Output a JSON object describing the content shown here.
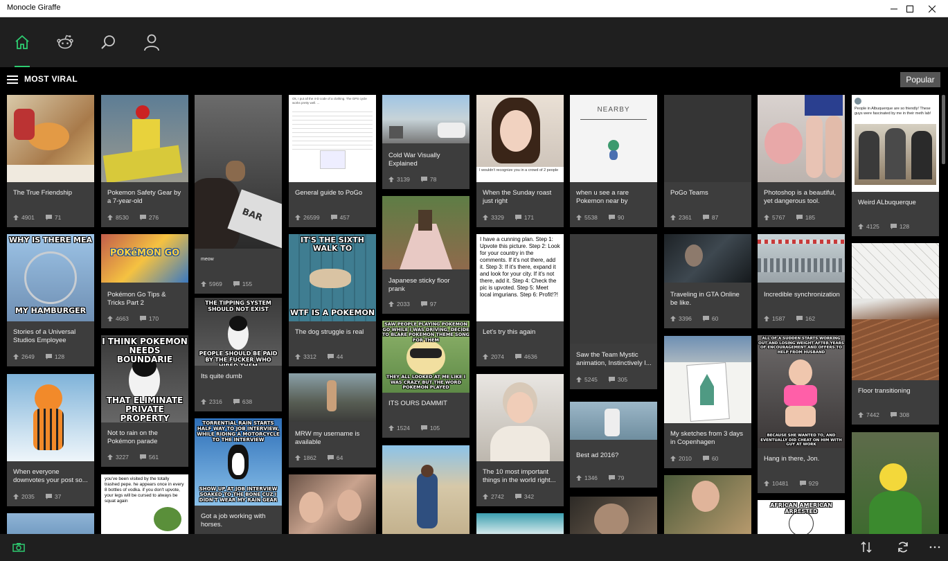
{
  "window": {
    "title": "Monocle Giraffe"
  },
  "nav": {
    "tabs": [
      {
        "name": "home",
        "active": true
      },
      {
        "name": "reddit",
        "active": false
      },
      {
        "name": "search",
        "active": false
      },
      {
        "name": "account",
        "active": false
      }
    ]
  },
  "section": {
    "title": "MOST VIRAL",
    "sort_label": "Popular"
  },
  "colors": {
    "accent": "#2ecc71",
    "card_bg": "#3d3d3d",
    "nav_bg": "#1f1f1f"
  },
  "meme_text": {
    "universal_top": "WHY IS THERE MEA",
    "universal_bottom": "MY HAMBURGER",
    "pokemon_logo": "POKéMON GO",
    "elevator_sign": "BAR",
    "puffin1_top": "THE TIPPING SYSTEM SHOULD NOT EXIST",
    "puffin1_bottom": "PEOPLE SHOULD BE PAID BY THE FUCKER WHO HIRED THEM",
    "puffin2_top": "I THINK POKEMON NEEDS BOUNDARIE",
    "puffin2_bottom": "THAT ELIMINATE PRIVATE PROPERTY",
    "penguin_top": "TORRENTIAL RAIN STARTS HALF WAY TO JOB INTERVIEW, WHILE RIDING A MOTORCYCLE TO THE INTERVIEW",
    "penguin_bottom": "SHOW UP AT JOB INTERVIEW SOAKED TO THE BONE CUZ I DIDN'T WEAR MY RAIN GEAR",
    "dog_top": "IT'S THE SIXTH WALK TO",
    "dog_bottom": "WTF IS A POKEMON",
    "farnsworth_top": "SAW PEOPLE PLAYING POKEMON GO WHILE I WAS DRIVING, DECIDE TO BLARE POKEMON THEME SONG FOR THEM",
    "farnsworth_bottom": "THEY ALL LOOKED AT ME LIKE I WAS CRAZY BUT THE WORD POKEMON PLAYED",
    "nearby": "NEARBY",
    "tweet_text": "People in Albuquerque are so friendly! These guys were fascinated by me in their meth lab!",
    "pepe_text": "you've been visited by the totally trashed pepe. he appears once in every 8 bottles of vodka. if you don't upvote, your legs will be cursed to always be squat again",
    "fat_text": "ALL OF A SUDDEN STARTS WORKING OUT AND LOSING WEIGHT AFTER YEARS OF ENCOURAGEMENT AND OFFERS TO HELP FROM HUSBAND",
    "fat_bottom": "BECAUSE SHE WANTED TO, AND EVENTUALLY DID CHEAT ON HIM WITH GUY AT WORK",
    "arrested": "AFRICAN AMERICAN ARRESTED",
    "plan": "I have a cunning plan. Step 1: Upvote this picture. Step 2: Look for your country in the comments. If it's not there, add it. Step 3: If it's there, expand it and look for your city. If it's not there, add it. Step 4: Check the pic is upvoted. Step 5: Meet local imgurians. Step 6: Profit!?!",
    "doc_guide": "Ok, I put all the 4-D code of a clothing. The GPS cycle works pretty well. ...",
    "sunday_caption": "I wouldn't recognize you in a crowd of 2 people"
  },
  "cards": [
    {
      "title": "The True Friendship",
      "ups": "4901",
      "comments": "71"
    },
    {
      "title": "Stories of a Universal Studios Employee",
      "ups": "2649",
      "comments": "128"
    },
    {
      "title": "When everyone downvotes your post so...",
      "ups": "2035",
      "comments": "37"
    },
    {
      "title": "Pokemon Safety Gear by a 7-year-old",
      "ups": "8530",
      "comments": "276"
    },
    {
      "title": "Pokémon Go Tips & Tricks Part 2",
      "ups": "4663",
      "comments": "170"
    },
    {
      "title": "Not to rain on the Pokémon parade",
      "ups": "3227",
      "comments": "561"
    },
    {
      "title": "meow",
      "ups": "5969",
      "comments": "155"
    },
    {
      "title": "Its quite dumb",
      "ups": "2316",
      "comments": "638"
    },
    {
      "title": "Got a job working with horses.",
      "ups": "",
      "comments": ""
    },
    {
      "title": "General guide to PoGo",
      "ups": "26599",
      "comments": "457"
    },
    {
      "title": "The dog struggle is real",
      "ups": "3312",
      "comments": "44"
    },
    {
      "title": "MRW my username is available",
      "ups": "1862",
      "comments": "64"
    },
    {
      "title": "Cold War Visually Explained",
      "ups": "3139",
      "comments": "78"
    },
    {
      "title": "Japanese sticky floor prank",
      "ups": "2033",
      "comments": "97"
    },
    {
      "title": "ITS OURS DAMMIT",
      "ups": "1524",
      "comments": "105"
    },
    {
      "title": "When the Sunday roast just right",
      "ups": "3329",
      "comments": "171"
    },
    {
      "title": "Let's try this again",
      "ups": "2074",
      "comments": "4636"
    },
    {
      "title": "The 10 most important things in the world right...",
      "ups": "2742",
      "comments": "342"
    },
    {
      "title": "when u see a rare Pokemon near by",
      "ups": "5538",
      "comments": "90"
    },
    {
      "title": "Saw the Team Mystic animation, Instinctively I...",
      "ups": "5245",
      "comments": "305"
    },
    {
      "title": "Best ad 2016?",
      "ups": "1346",
      "comments": "79"
    },
    {
      "title": "PoGo Teams",
      "ups": "2361",
      "comments": "87"
    },
    {
      "title": "Traveling in GTA Online be like.",
      "ups": "3396",
      "comments": "60"
    },
    {
      "title": "My sketches from 3 days in Copenhagen",
      "ups": "2010",
      "comments": "60"
    },
    {
      "title": "Photoshop is a beautiful, yet dangerous tool.",
      "ups": "5767",
      "comments": "185"
    },
    {
      "title": "Incredible synchronization",
      "ups": "1587",
      "comments": "162"
    },
    {
      "title": "Hang in there, Jon.",
      "ups": "10481",
      "comments": "929"
    },
    {
      "title": "Weird ALbuquerque",
      "ups": "4125",
      "comments": "128"
    },
    {
      "title": "Floor transitioning",
      "ups": "7442",
      "comments": "308"
    }
  ]
}
